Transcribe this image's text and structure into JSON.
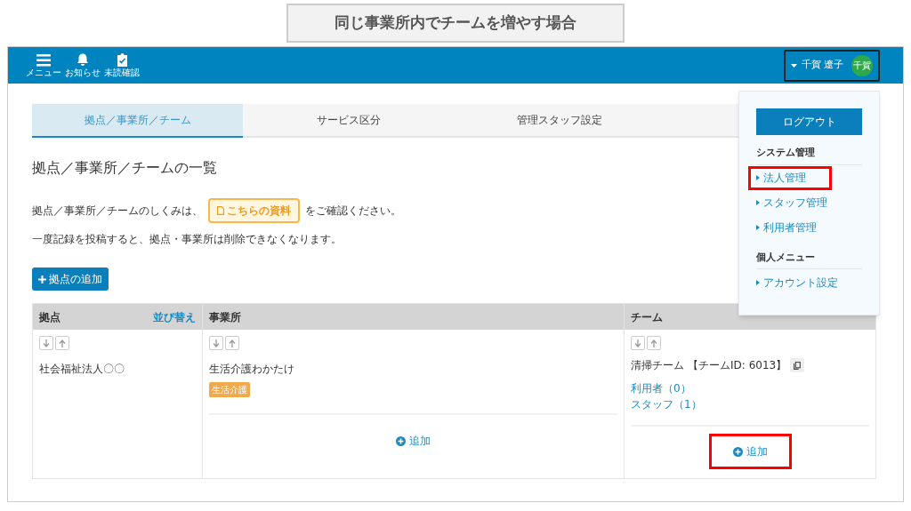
{
  "caption": "同じ事業所内でチームを増やす場合",
  "header": {
    "icons": [
      {
        "kind": "menu",
        "label": "メニュー"
      },
      {
        "kind": "bell",
        "label": "お知らせ"
      },
      {
        "kind": "clipboard",
        "label": "未読確認"
      }
    ],
    "user": {
      "name": "千賀 遼子",
      "avatar": "千賀"
    }
  },
  "user_menu": {
    "logout": "ログアウト",
    "sections": [
      {
        "heading": "システム管理",
        "items": [
          {
            "label": "法人管理",
            "highlighted": true
          },
          {
            "label": "スタッフ管理",
            "highlighted": false
          },
          {
            "label": "利用者管理",
            "highlighted": false
          }
        ]
      },
      {
        "heading": "個人メニュー",
        "items": [
          {
            "label": "アカウント設定",
            "highlighted": false
          }
        ]
      }
    ]
  },
  "tabs": [
    {
      "label": "拠点／事業所／チーム",
      "selected": true
    },
    {
      "label": "サービス区分",
      "selected": false
    },
    {
      "label": "管理スタッフ設定",
      "selected": false
    }
  ],
  "title": "拠点／事業所／チームの一覧",
  "notice": {
    "before": "拠点／事業所／チームのしくみは、",
    "link": "こちらの資料",
    "after": "をご確認ください。"
  },
  "warning": "一度記録を投稿すると、拠点・事業所は削除できなくなります。",
  "add_base_button": "拠点の追加",
  "table": {
    "columns": [
      {
        "label": "拠点",
        "action": "並び替え"
      },
      {
        "label": "事業所"
      },
      {
        "label": "チーム"
      }
    ],
    "base": {
      "name": "社会福祉法人〇〇"
    },
    "office": {
      "name": "生活介護わかたけ",
      "tag": "生活介護",
      "add": "追加",
      "add_highlighted": false
    },
    "team": {
      "name": "清掃チーム",
      "id": "【チームID: 6013】",
      "links": [
        "利用者（0）",
        "スタッフ（1）"
      ],
      "add": "追加",
      "add_highlighted": true
    }
  }
}
